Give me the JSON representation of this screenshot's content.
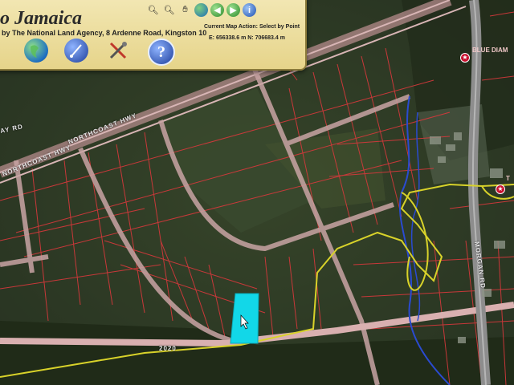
{
  "header": {
    "title": "o Jamaica",
    "credit": "by The National Land Agency, 8 Ardenne Road, Kingston 10",
    "map_action": "Current Map Action: Select by Point",
    "coords": "E: 656338.6 m   N: 706683.4 m"
  },
  "toolbar_top": [
    {
      "name": "zoom-in-icon",
      "glyph": "🔍︎"
    },
    {
      "name": "zoom-out-icon",
      "glyph": "🔍︎"
    },
    {
      "name": "pan-hand-icon",
      "glyph": "✋︎"
    },
    {
      "name": "full-extent-globe-icon",
      "glyph": ""
    },
    {
      "name": "back-arrow-icon",
      "glyph": "◀"
    },
    {
      "name": "forward-arrow-icon",
      "glyph": "▶"
    },
    {
      "name": "info-icon",
      "glyph": "i"
    }
  ],
  "toolbar_big": [
    {
      "name": "globe-icon"
    },
    {
      "name": "measure-icon"
    },
    {
      "name": "tools-icon"
    },
    {
      "name": "help-icon",
      "glyph": "?"
    }
  ],
  "map": {
    "road_labels": {
      "northcoast_hwy_1": "NORTHCOAST HWY",
      "northcoast_hwy_2": "NORTHCOAST HWY",
      "northcoast_hwy_3": "NORTHCOAST HWY",
      "road_2020": "2020",
      "morgan_rd": "MORGAN RD",
      "ay_rd": "AY RD"
    },
    "poi": {
      "blue_diamond": "BLUE DIAM",
      "t_label": "T"
    },
    "colors": {
      "parcel_line": "#d9383c",
      "road": "#c9a4a4",
      "selected_parcel": "#12d7e8",
      "flood_line": "#d8d22a",
      "river": "#2a4bd1"
    }
  }
}
